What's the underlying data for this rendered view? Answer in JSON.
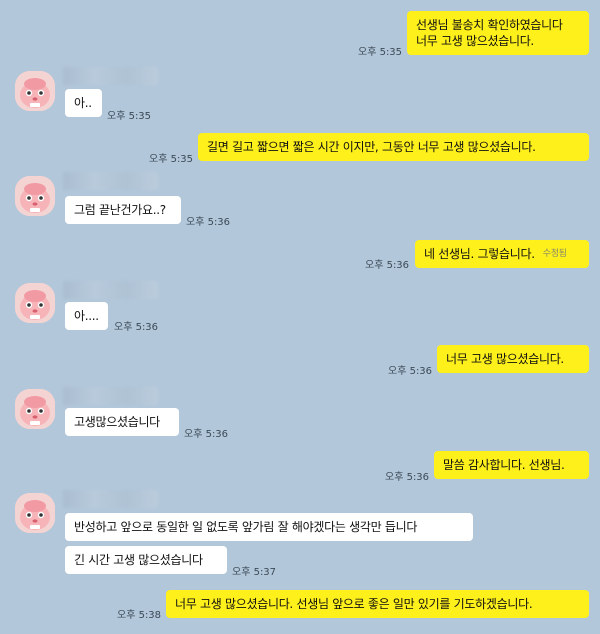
{
  "chat": {
    "messages": [
      {
        "side": "me",
        "lines": [
          "선생님 불송치 확인하였습니다",
          "너무 고생 많으셨습니다."
        ],
        "time": "오후 5:35"
      },
      {
        "side": "other",
        "lines": [
          "아.."
        ],
        "time": "오후 5:35"
      },
      {
        "side": "me",
        "lines": [
          "길면 길고 짧으면 짧은 시간 이지만, 그동안 너무 고생 많으셨습니다."
        ],
        "time": "오후 5:35"
      },
      {
        "side": "other",
        "lines": [
          "그럼 끝난건가요..?"
        ],
        "time": "오후 5:36"
      },
      {
        "side": "me",
        "lines": [
          "네 선생님. 그렇습니다."
        ],
        "time": "오후 5:36",
        "edited": "수정됨"
      },
      {
        "side": "other",
        "lines": [
          "아...."
        ],
        "time": "오후 5:36"
      },
      {
        "side": "me",
        "lines": [
          "너무 고생 많으셨습니다."
        ],
        "time": "오후 5:36"
      },
      {
        "side": "other",
        "lines": [
          "고생많으셨습니다"
        ],
        "time": "오후 5:36"
      },
      {
        "side": "me",
        "lines": [
          "말씀 감사합니다. 선생님."
        ],
        "time": "오후 5:36"
      },
      {
        "side": "other",
        "lines": [
          "반성하고 앞으로 동일한 일 없도록 앞가림 잘 해야겠다는 생각만 듭니다"
        ],
        "time": ""
      },
      {
        "side": "other",
        "lines": [
          "긴 시간 고생 많으셨습니다"
        ],
        "time": "오후 5:37"
      },
      {
        "side": "me",
        "lines": [
          "너무 고생 많으셨습니다. 선생님 앞으로 좋은 일만 있기를 기도하겠습니다."
        ],
        "time": "오후 5:38"
      }
    ]
  },
  "avatar": {
    "icon": "pink-character-avatar-icon",
    "bg": "#f4d3d3"
  },
  "colors": {
    "background": "#b2c7da",
    "my_bubble": "#fef01b",
    "their_bubble": "#ffffff"
  }
}
